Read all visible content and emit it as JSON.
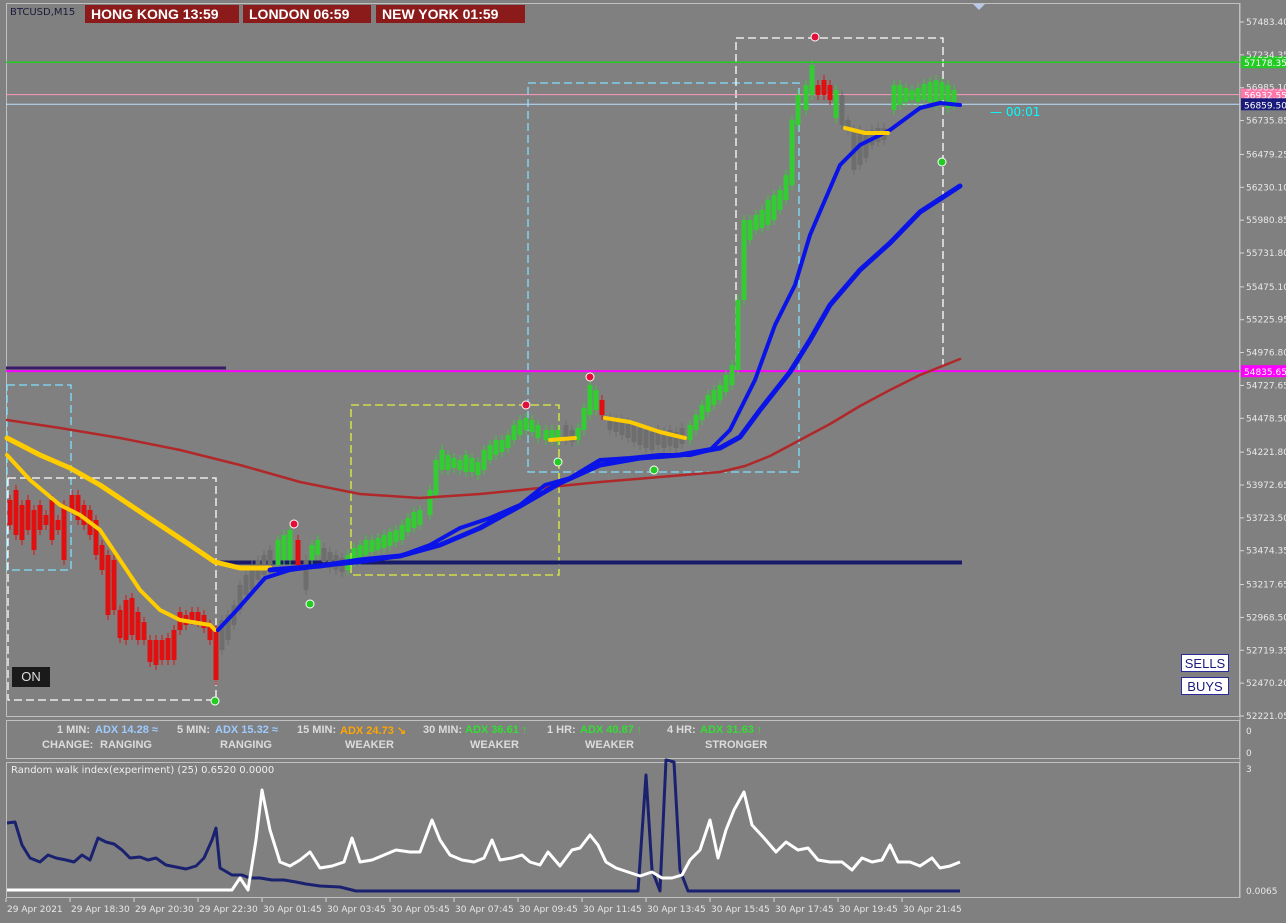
{
  "symbol": "BTCUSD,M15",
  "clocks": [
    {
      "label": "HONG KONG 13:59"
    },
    {
      "label": "LONDON  06:59"
    },
    {
      "label": "NEW YORK  01:59"
    }
  ],
  "price_axis": [
    "57483.40",
    "57234.35",
    "56985.10",
    "56735.85",
    "56479.25",
    "56230.10",
    "55980.85",
    "55731.80",
    "55475.10",
    "55225.95",
    "54976.80",
    "54727.65",
    "54478.50",
    "54221.80",
    "53972.65",
    "53723.50",
    "53474.35",
    "53217.65",
    "52968.50",
    "52719.35",
    "52470.20",
    "52221.05"
  ],
  "price_tags": [
    {
      "text": "57178.35",
      "color": "#22cc22"
    },
    {
      "text": "56932.55",
      "color": "#ff77aa"
    },
    {
      "text": "56859.50",
      "color": "#1a1a7a"
    },
    {
      "text": "54835.65",
      "color": "#ff00ff"
    }
  ],
  "candle_timer": "00:01",
  "on_button": "ON",
  "sells_button": "SELLS",
  "buys_button": "BUYS",
  "adx_rows": [
    {
      "tf": "1 MIN:",
      "adx": "ADX 14.28",
      "arrow": "≈",
      "color": "#9ecbff",
      "state": "RANGING"
    },
    {
      "tf": "5 MIN:",
      "adx": "ADX 15.32",
      "arrow": "≈",
      "color": "#9ecbff",
      "state": "RANGING"
    },
    {
      "tf": "15 MIN:",
      "adx": "ADX 24.73",
      "arrow": "↘",
      "color": "#ffa500",
      "state": "WEAKER"
    },
    {
      "tf": "30 MIN:",
      "adx": "ADX 36.61",
      "arrow": "↑",
      "color": "#33dd33",
      "state": "WEAKER"
    },
    {
      "tf": "1 HR:",
      "adx": "ADX 40.87",
      "arrow": "↑",
      "color": "#33dd33",
      "state": "WEAKER"
    },
    {
      "tf": "4 HR:",
      "adx": "ADX 31.63",
      "arrow": "↑",
      "color": "#33dd33",
      "state": "STRONGER"
    }
  ],
  "change_label": "CHANGE:",
  "adx_panel_axis": [
    "0",
    "0"
  ],
  "rwi_title": "Random walk index(experiment) (25) 0.6520 0.0000",
  "rwi_axis": [
    "3",
    "0.0065"
  ],
  "time_axis": [
    "29 Apr 2021",
    "29 Apr 18:30",
    "29 Apr 20:30",
    "29 Apr 22:30",
    "30 Apr 01:45",
    "30 Apr 03:45",
    "30 Apr 05:45",
    "30 Apr 07:45",
    "30 Apr 09:45",
    "30 Apr 11:45",
    "30 Apr 13:45",
    "30 Apr 15:45",
    "30 Apr 17:45",
    "30 Apr 19:45",
    "30 Apr 21:45"
  ],
  "colors": {
    "background": "#808080",
    "bull": "#33cc33",
    "bear": "#e01010",
    "fast_ma": "#ffcc00",
    "ma_blue": "#0a14e6",
    "ma_red": "#b0282a",
    "rwi_high": "#ffffff",
    "rwi_low": "#1a2270"
  },
  "chart_data": {
    "type": "candlestick",
    "y_range": [
      52221.05,
      57483.4
    ],
    "horizontal_levels": [
      57178.35,
      56932.55,
      56859.5,
      54835.65,
      53385
    ],
    "series": [
      {
        "name": "fast_ma",
        "color": "#ffcc00"
      },
      {
        "name": "mid_ma",
        "color": "#0a14e6"
      },
      {
        "name": "slow_ma",
        "color": "#0a14e6"
      },
      {
        "name": "long_ma",
        "color": "#b0282a"
      }
    ]
  }
}
